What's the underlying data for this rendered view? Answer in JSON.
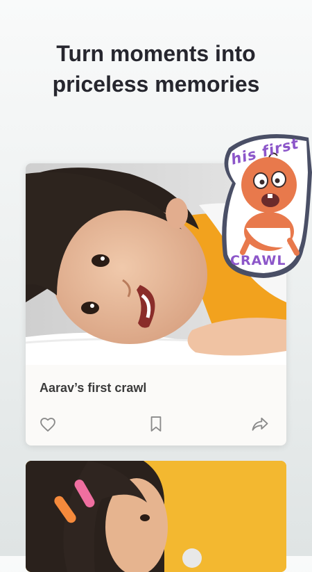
{
  "headline": {
    "line1": "Turn moments into",
    "line2": "priceless memories"
  },
  "memory_card": {
    "title": "Aarav’s first crawl",
    "actions": {
      "like_icon": "heart-outline-icon",
      "save_icon": "bookmark-outline-icon",
      "share_icon": "share-arrow-icon"
    }
  },
  "sticker": {
    "text_top": "his first",
    "text_bottom": "CRAWL"
  },
  "colors": {
    "headline": "#26262e",
    "sticker_purple": "#8c56c9",
    "sticker_green": "#47b43c",
    "sticker_baby": "#e8794c",
    "card2_background": "#f3b830"
  }
}
